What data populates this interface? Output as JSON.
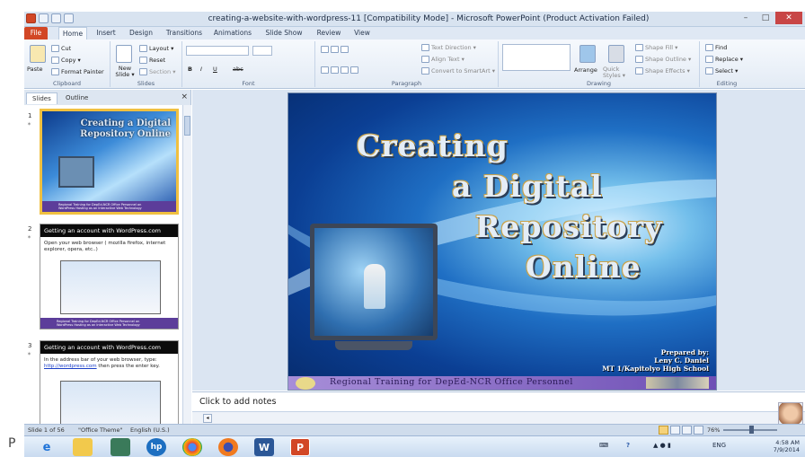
{
  "window": {
    "title": "creating-a-website-with-wordpress-11 [Compatibility Mode] - Microsoft PowerPoint (Product Activation Failed)",
    "controls": [
      "–",
      "□",
      "✕"
    ]
  },
  "tabs": [
    "File",
    "Home",
    "Insert",
    "Design",
    "Transitions",
    "Animations",
    "Slide Show",
    "Review",
    "View"
  ],
  "ribbon": {
    "clipboard": {
      "paste": "Paste",
      "cut": "Cut",
      "copy": "Copy ▾",
      "format_painter": "Format Painter",
      "label": "Clipboard"
    },
    "slides": {
      "new_slide": "New Slide ▾",
      "layout": "Layout ▾",
      "reset": "Reset",
      "section": "Section ▾",
      "label": "Slides"
    },
    "font": {
      "label": "Font",
      "bold": "B",
      "italic": "I",
      "underline": "U",
      "strike": "abc"
    },
    "paragraph": {
      "text_direction": "Text Direction ▾",
      "align_text": "Align Text ▾",
      "convert": "Convert to SmartArt ▾",
      "label": "Paragraph"
    },
    "drawing": {
      "arrange": "Arrange",
      "quick_styles": "Quick Styles ▾",
      "shape_fill": "Shape Fill ▾",
      "shape_outline": "Shape Outline ▾",
      "shape_effects": "Shape Effects ▾",
      "label": "Drawing"
    },
    "editing": {
      "find": "Find",
      "replace": "Replace ▾",
      "select": "Select ▾",
      "label": "Editing"
    }
  },
  "panes": {
    "tab_slides": "Slides",
    "tab_outline": "Outline",
    "close": "×"
  },
  "thumbnails": [
    {
      "num": "1",
      "title": "Creating a Digital Repository Online",
      "footer": "Regional Training for DepEd-NCR Office Personnel on WordPress Hosting as an Interactive Web Technology"
    },
    {
      "num": "2",
      "header": "Getting an account with WordPress.com",
      "bullet": "Open your web browser ( mozilla firefox, internet explorer, opera, etc..)"
    },
    {
      "num": "3",
      "header": "Getting an account with WordPress.com",
      "bullet": "In the address bar of your web browser, type:",
      "link": "http://wordpress.com",
      "bullet_tail": "then press the enter key."
    }
  ],
  "slide": {
    "title_lines": [
      "Creating",
      "a Digital",
      "Repository",
      "Online"
    ],
    "prepared": [
      "Prepared by:",
      "Leny C. Daniel",
      "MT 1/Kapitolyo High School"
    ],
    "footer": "Regional Training for DepEd-NCR Office Personnel"
  },
  "notes": {
    "placeholder": "Click to add notes"
  },
  "status": {
    "slide_of": "Slide 1 of 56",
    "theme": "\"Office Theme\"",
    "language": "English (U.S.)",
    "zoom": "76%"
  },
  "taskbar": {
    "apps": [
      "internet-explorer",
      "file-explorer",
      "photos",
      "hp",
      "chrome",
      "firefox",
      "word",
      "powerpoint"
    ],
    "tray_lang": "ENG",
    "time": "4:58 AM",
    "date": "7/9/2014"
  },
  "left_edge_char": "P"
}
